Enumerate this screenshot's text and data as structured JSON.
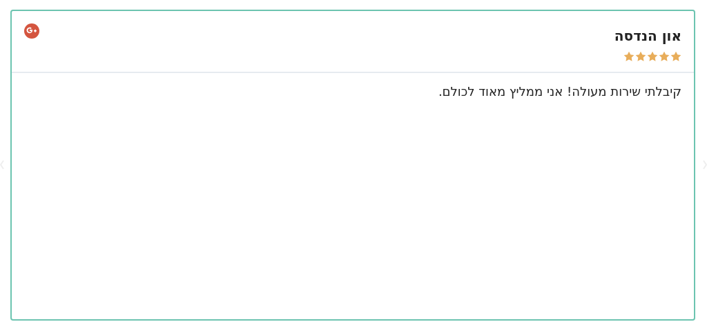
{
  "review": {
    "author": "און הנדסה",
    "stars": 5,
    "text": "קיבלתי שירות מעולה! אני ממליץ מאוד לכולם."
  }
}
